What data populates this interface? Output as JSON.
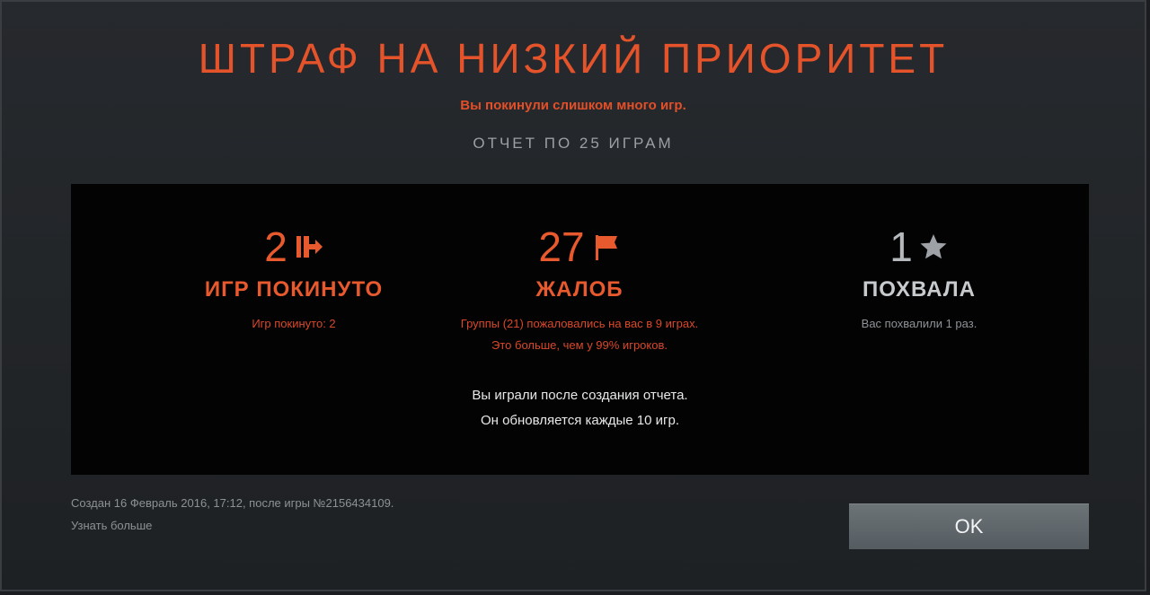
{
  "dialog": {
    "title": "ШТРАФ НА НИЗКИЙ ПРИОРИТЕТ",
    "subtitle": "Вы покинули слишком много игр.",
    "report_label": "ОТЧЕТ ПО 25 ИГРАМ"
  },
  "stats": {
    "abandoned": {
      "count": "2",
      "icon": "exit-door-icon",
      "label": "ИГР ПОКИНУТО",
      "desc": "Игр покинуто: 2"
    },
    "reports": {
      "count": "27",
      "icon": "flag-icon",
      "label": "ЖАЛОБ",
      "desc_line1": "Группы (21) пожаловались на вас в 9 играх.",
      "desc_line2": "Это больше, чем у 99% игроков."
    },
    "commends": {
      "count": "1",
      "icon": "star-icon",
      "label": "ПОХВАЛА",
      "desc": "Вас похвалили 1 раз."
    }
  },
  "update_note": {
    "line1": "Вы играли после создания отчета.",
    "line2": "Он обновляется каждые 10 игр."
  },
  "footer": {
    "created": "Создан 16 Февраль 2016, 17:12, после игры №2156434109.",
    "learn_more": "Узнать больше",
    "ok_label": "OK"
  },
  "colors": {
    "accent": "#e5532b",
    "panel_bg": "#030304",
    "dialog_bg": "#24272b",
    "button_bg": "#5f666b"
  }
}
